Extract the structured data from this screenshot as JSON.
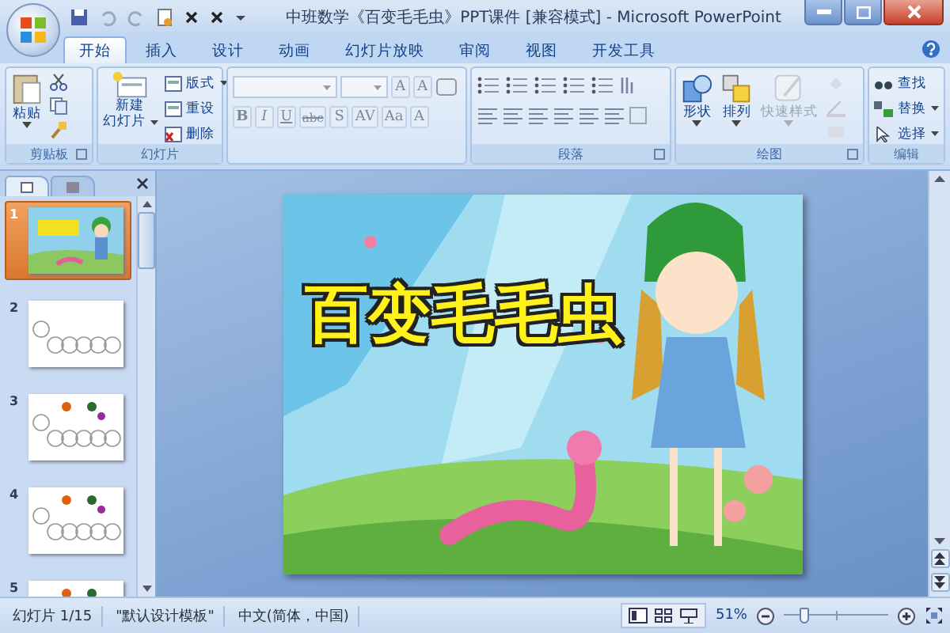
{
  "window": {
    "title": "中班数学《百变毛毛虫》PPT课件 [兼容模式] - Microsoft PowerPoint"
  },
  "tabs": [
    {
      "label": "开始",
      "selected": true
    },
    {
      "label": "插入",
      "selected": false
    },
    {
      "label": "设计",
      "selected": false
    },
    {
      "label": "动画",
      "selected": false
    },
    {
      "label": "幻灯片放映",
      "selected": false
    },
    {
      "label": "审阅",
      "selected": false
    },
    {
      "label": "视图",
      "selected": false
    },
    {
      "label": "开发工具",
      "selected": false
    }
  ],
  "ribbon": {
    "clipboard": {
      "label": "剪贴板",
      "paste": "粘贴"
    },
    "slides": {
      "label": "幻灯片",
      "new_slide": [
        "新建",
        "幻灯片"
      ],
      "items": [
        "版式",
        "重设",
        "删除"
      ]
    },
    "font": {
      "disabled": true,
      "row1": [
        "A",
        "A"
      ],
      "row2": [
        "B",
        "I",
        "U",
        "abc",
        "S",
        "AV",
        "Aa",
        "A"
      ]
    },
    "paragraph": {
      "label": "段落"
    },
    "drawing": {
      "label": "绘图",
      "buttons": [
        {
          "label": "形状",
          "disabled": false
        },
        {
          "label": "排列",
          "disabled": false
        },
        {
          "label": "快速样式",
          "disabled": true
        }
      ]
    },
    "editing": {
      "label": "编辑",
      "items": [
        "查找",
        "替换",
        "选择"
      ]
    }
  },
  "slide_panel": {
    "slides": [
      {
        "number": "1",
        "selected": true,
        "kind": "title"
      },
      {
        "number": "2",
        "selected": false,
        "kind": "caterpillar"
      },
      {
        "number": "3",
        "selected": false,
        "kind": "caterpillar"
      },
      {
        "number": "4",
        "selected": false,
        "kind": "caterpillar"
      },
      {
        "number": "5",
        "selected": false,
        "kind": "caterpillar"
      }
    ]
  },
  "slide": {
    "title": "百变毛毛虫"
  },
  "status_bar": {
    "slide": "幻灯片 1/15",
    "theme": "\"默认设计模板\"",
    "language": "中文(简体，中国)",
    "zoom": "51%",
    "zoom_slider": {
      "level": 0.2
    }
  }
}
